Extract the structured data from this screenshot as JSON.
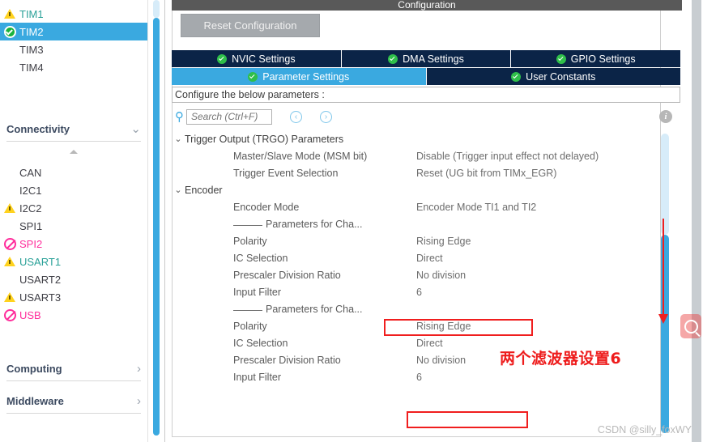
{
  "window": {
    "title": "Configuration"
  },
  "sidebar": {
    "timers": [
      {
        "label": "TIM1",
        "status": "warning-icon",
        "selected": false,
        "style": "teal"
      },
      {
        "label": "TIM2",
        "status": "check-icon",
        "selected": true,
        "style": "selected"
      },
      {
        "label": "TIM3",
        "status": "none",
        "selected": false,
        "style": "plain"
      },
      {
        "label": "TIM4",
        "status": "none",
        "selected": false,
        "style": "plain"
      }
    ],
    "connectivity": {
      "label": "Connectivity",
      "chevron": "chevron-down-icon",
      "items": [
        {
          "label": "CAN",
          "status": "none",
          "style": "plain"
        },
        {
          "label": "I2C1",
          "status": "none",
          "style": "plain"
        },
        {
          "label": "I2C2",
          "status": "warning-icon",
          "style": "plain"
        },
        {
          "label": "SPI1",
          "status": "none",
          "style": "plain"
        },
        {
          "label": "SPI2",
          "status": "banned-icon",
          "style": "magenta"
        },
        {
          "label": "USART1",
          "status": "warning-icon",
          "style": "teal"
        },
        {
          "label": "USART2",
          "status": "none",
          "style": "plain"
        },
        {
          "label": "USART3",
          "status": "warning-icon",
          "style": "plain"
        },
        {
          "label": "USB",
          "status": "banned-icon",
          "style": "magenta"
        }
      ]
    },
    "computing": {
      "label": "Computing",
      "chevron": "chevron-right-icon"
    },
    "middleware": {
      "label": "Middleware",
      "chevron": "chevron-right-icon"
    }
  },
  "panel": {
    "reset_label": "Reset Configuration",
    "tabs_row1": [
      {
        "label": "NVIC Settings",
        "active": false
      },
      {
        "label": "DMA Settings",
        "active": false
      },
      {
        "label": "GPIO Settings",
        "active": false
      }
    ],
    "tabs_row2": [
      {
        "label": "Parameter Settings",
        "active": true
      },
      {
        "label": "User Constants",
        "active": false
      }
    ],
    "configure_text": "Configure the below parameters :",
    "search_placeholder": "Search (Ctrl+F)",
    "search_value": "",
    "nav_prev": "‹",
    "nav_next": "›",
    "info_label": "i"
  },
  "tree": {
    "groups": [
      {
        "name": "Trigger Output (TRGO) Parameters",
        "expanded": true,
        "rows": [
          {
            "name": "Master/Slave Mode (MSM bit)",
            "value": "Disable (Trigger input effect not delayed)",
            "highlighted": false
          },
          {
            "name": "Trigger Event Selection",
            "value": "Reset (UG bit from TIMx_EGR)",
            "highlighted": false
          }
        ]
      },
      {
        "name": "Encoder",
        "expanded": true,
        "rows": [
          {
            "name": "Encoder Mode",
            "value": "Encoder Mode TI1 and TI2",
            "highlighted": false
          }
        ],
        "subsections": [
          {
            "title": "Parameters for Cha...",
            "rows": [
              {
                "name": "Polarity",
                "value": "Rising Edge",
                "highlighted": false
              },
              {
                "name": "IC Selection",
                "value": "Direct",
                "highlighted": false
              },
              {
                "name": "Prescaler Division Ratio",
                "value": "No division",
                "highlighted": false
              },
              {
                "name": "Input Filter",
                "value": "6",
                "highlighted": true
              }
            ]
          },
          {
            "title": "Parameters for Cha...",
            "rows": [
              {
                "name": "Polarity",
                "value": "Rising Edge",
                "highlighted": false
              },
              {
                "name": "IC Selection",
                "value": "Direct",
                "highlighted": false
              },
              {
                "name": "Prescaler Division Ratio",
                "value": "No division",
                "highlighted": false
              },
              {
                "name": "Input Filter",
                "value": "6",
                "highlighted": true
              }
            ]
          }
        ]
      }
    ]
  },
  "annotations": {
    "chinese_note": "两个滤波器设置6",
    "note_color": "#ee1c1c",
    "arrow": "down-arrow-annotation"
  },
  "watermark": {
    "text": "CSDN @silly_foxWY"
  },
  "colors": {
    "accent_blue": "#3aa9e0",
    "tab_navy": "#0b2447",
    "annotation_red": "#ee1c1c",
    "warning_yellow": "#ffd21e",
    "ok_green": "#19b33d",
    "disabled_magenta": "#ff2d9b"
  }
}
